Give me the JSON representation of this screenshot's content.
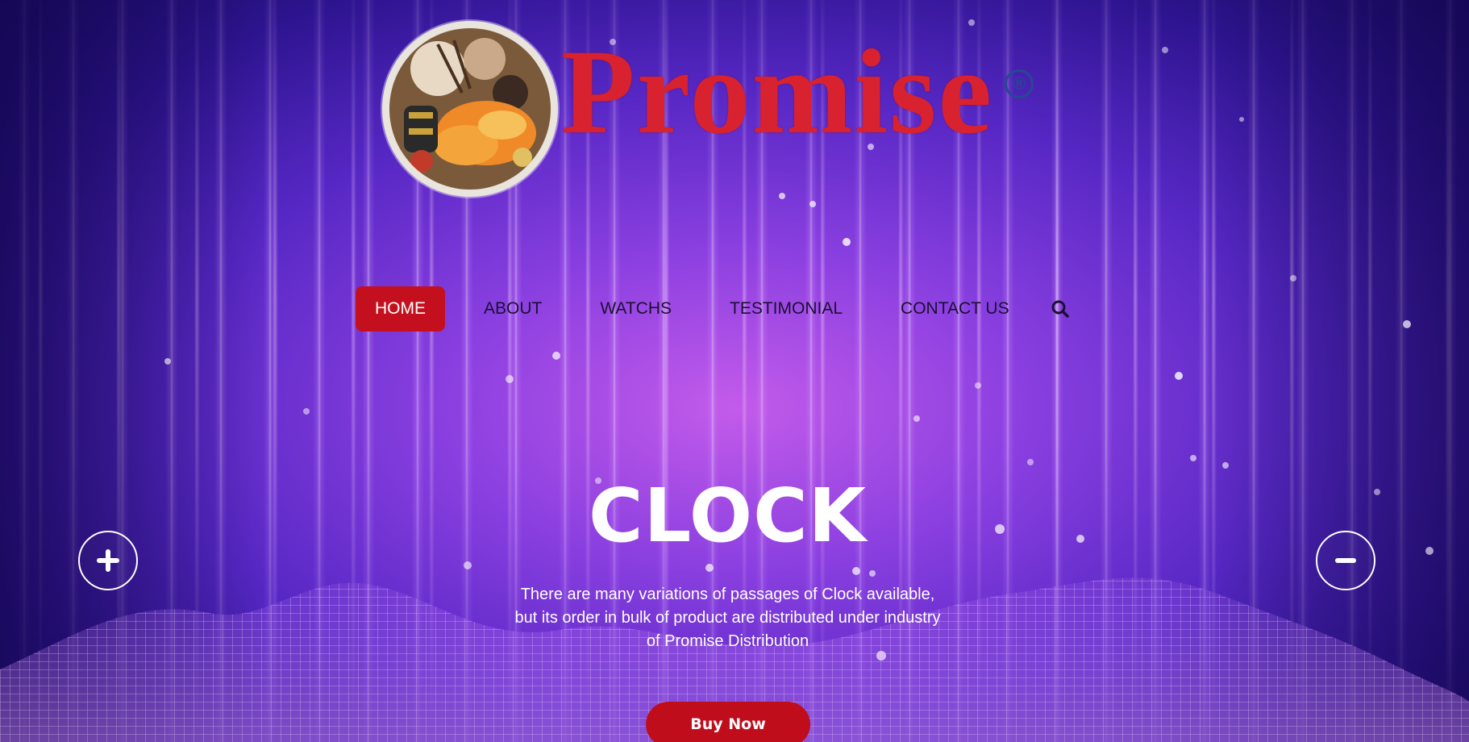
{
  "brand": {
    "name": "Promise",
    "registered_mark": "®",
    "emblem_icon": "promise-emblem-photo"
  },
  "nav": {
    "items": [
      {
        "label": "HOME",
        "active": true
      },
      {
        "label": "ABOUT",
        "active": false
      },
      {
        "label": "WATCHS",
        "active": false
      },
      {
        "label": "TESTIMONIAL",
        "active": false
      },
      {
        "label": "CONTACT US",
        "active": false
      }
    ],
    "search_icon": "search-icon"
  },
  "hero": {
    "title": "CLOCK",
    "description": "There are many variations of passages of Clock available, but its order in bulk of product are distributed under industry of Promise Distribution",
    "cta_label": "Buy Now",
    "prev_icon": "plus-icon",
    "next_icon": "minus-icon"
  },
  "colors": {
    "accent": "#c4101e",
    "brand_red": "#d8222f",
    "background_primary": "#8a3fe0",
    "text_light": "#ffffff",
    "nav_text": "#1a1033"
  }
}
